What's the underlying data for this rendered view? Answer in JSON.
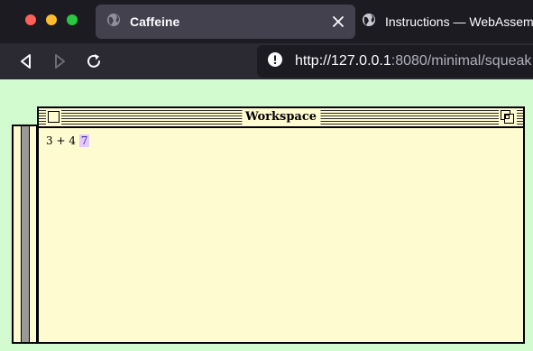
{
  "browser": {
    "tabs": [
      {
        "title": "Caffeine",
        "active": true,
        "icon": "globe-icon"
      },
      {
        "title": "Instructions — WebAssembly",
        "active": false,
        "icon": "globe-icon"
      }
    ],
    "url": {
      "host": "http://127.0.0.1",
      "port": ":8080",
      "path": "/minimal/squeak"
    }
  },
  "workspace": {
    "title": "Workspace",
    "code": "3 + 4",
    "result": "7"
  },
  "colors": {
    "page_bg": "#d2fbd0",
    "window_bg": "#fffbd0",
    "highlight": "#e6c9ff"
  }
}
